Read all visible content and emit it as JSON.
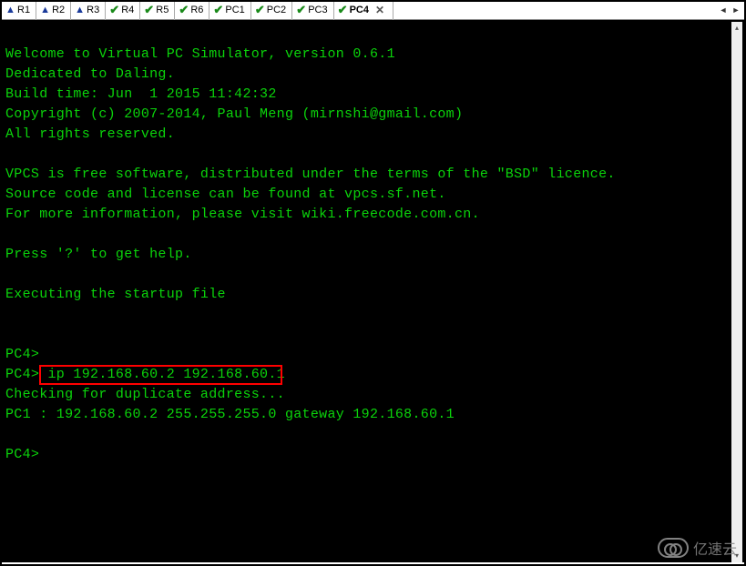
{
  "tabs": [
    {
      "icon": "warning",
      "label": "R1"
    },
    {
      "icon": "warning",
      "label": "R2"
    },
    {
      "icon": "warning",
      "label": "R3"
    },
    {
      "icon": "check",
      "label": "R4"
    },
    {
      "icon": "check",
      "label": "R5"
    },
    {
      "icon": "check",
      "label": "R6"
    },
    {
      "icon": "check",
      "label": "PC1"
    },
    {
      "icon": "check",
      "label": "PC2"
    },
    {
      "icon": "check",
      "label": "PC3"
    },
    {
      "icon": "check",
      "label": "PC4",
      "active": true
    }
  ],
  "terminal": {
    "lines": [
      "",
      "Welcome to Virtual PC Simulator, version 0.6.1",
      "Dedicated to Daling.",
      "Build time: Jun  1 2015 11:42:32",
      "Copyright (c) 2007-2014, Paul Meng (mirnshi@gmail.com)",
      "All rights reserved.",
      "",
      "VPCS is free software, distributed under the terms of the \"BSD\" licence.",
      "Source code and license can be found at vpcs.sf.net.",
      "For more information, please visit wiki.freecode.com.cn.",
      "",
      "Press '?' to get help.",
      "",
      "Executing the startup file",
      "",
      "",
      "PC4>",
      "PC4> ip 192.168.60.2 192.168.60.1",
      "Checking for duplicate address...",
      "PC1 : 192.168.60.2 255.255.255.0 gateway 192.168.60.1",
      "",
      "PC4>"
    ],
    "highlight": {
      "line_index": 17,
      "text": "ip 192.168.60.2 192.168.60.1"
    }
  },
  "watermark_text": "亿速云"
}
